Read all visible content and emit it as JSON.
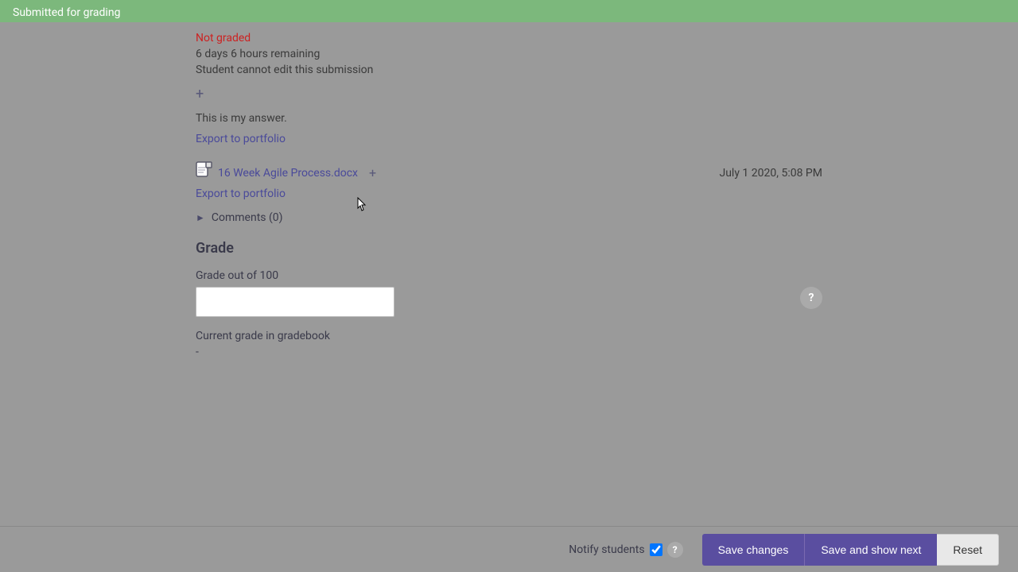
{
  "banner": {
    "text": "Submitted for grading"
  },
  "submission": {
    "not_graded": "Not graded",
    "time_remaining": "6 days 6 hours remaining",
    "edit_status": "Student cannot edit this submission",
    "answer_text": "This is my answer.",
    "export_link_1": "Export to portfolio"
  },
  "file": {
    "name": "16 Week Agile Process.docx",
    "date": "July 1 2020, 5:08 PM",
    "export_link": "Export to portfolio"
  },
  "comments": {
    "label": "Comments (0)"
  },
  "grade": {
    "heading": "Grade",
    "out_of_label": "Grade out of 100",
    "input_value": "",
    "input_placeholder": "",
    "current_grade_label": "Current grade in gradebook",
    "current_grade_value": "-",
    "help_icon_label": "?"
  },
  "bottom_bar": {
    "notify_students_label": "Notify students",
    "save_changes_label": "Save changes",
    "save_show_next_label": "Save and show next",
    "reset_label": "Reset",
    "help_icon_label": "?"
  }
}
